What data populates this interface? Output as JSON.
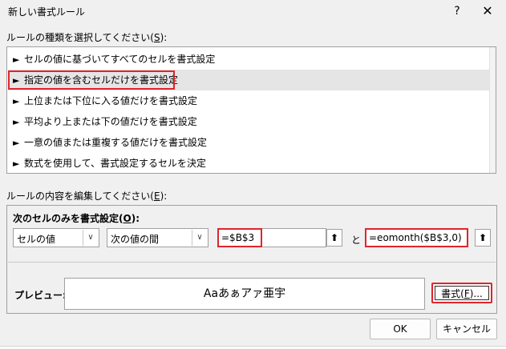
{
  "window": {
    "title": "新しい書式ルール",
    "help_glyph": "?",
    "close_glyph": "✕"
  },
  "rule_type": {
    "label_prefix": "ルールの種類を選択してください(",
    "label_key": "S",
    "label_suffix": "):",
    "items": [
      {
        "label": "セルの値に基づいてすべてのセルを書式設定"
      },
      {
        "label": "指定の値を含むセルだけを書式設定"
      },
      {
        "label": "上位または下位に入る値だけを書式設定"
      },
      {
        "label": "平均より上または下の値だけを書式設定"
      },
      {
        "label": "一意の値または重複する値だけを書式設定"
      },
      {
        "label": "数式を使用して、書式設定するセルを決定"
      }
    ],
    "selected_index": 1,
    "arrow_glyph": "►"
  },
  "rule_content": {
    "label_prefix": "ルールの内容を編集してください(",
    "label_key": "E",
    "label_suffix": "):",
    "heading_prefix": "次のセルのみを書式設定(",
    "heading_key": "O",
    "heading_suffix": "):",
    "combo1": "セルの値",
    "combo2": "次の値の間",
    "value1": "=$B$3",
    "and_label": "と",
    "value2": "=eomonth($B$3,0)",
    "ref_glyph": "⬆",
    "dropdown_glyph": "∨"
  },
  "preview": {
    "label": "プレビュー:",
    "sample_text": "Aaあぁアァ亜宇",
    "format_btn_prefix": "書式(",
    "format_btn_key": "F",
    "format_btn_suffix": ")..."
  },
  "buttons": {
    "ok": "OK",
    "cancel": "キャンセル"
  },
  "colors": {
    "highlight_red": "#e0242d",
    "dialog_bg": "#f0f0f0",
    "selected_row_bg": "#e5e5e5"
  }
}
